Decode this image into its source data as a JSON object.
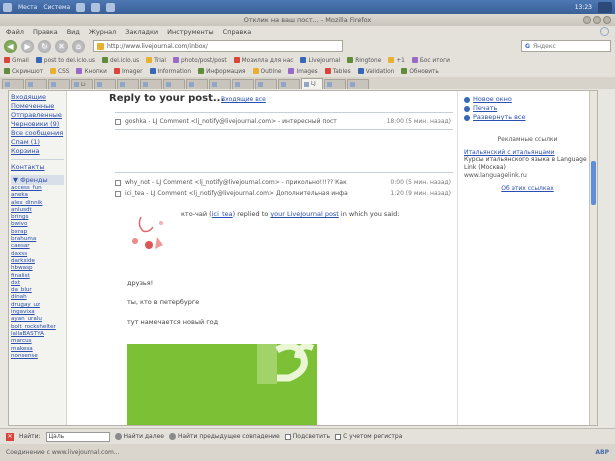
{
  "panel": {
    "labels": [
      "Места",
      "Система"
    ],
    "clock": "13:23"
  },
  "window": {
    "title": "Отклик на ваш пост... - Mozilla Firefox"
  },
  "menu": [
    "Файл",
    "Правка",
    "Вид",
    "Журнал",
    "Закладки",
    "Инструменты",
    "Справка"
  ],
  "nav": {
    "url": "http://www.livejournal.com/inbox/",
    "search_engine": "G",
    "search_placeholder": "Яндекс"
  },
  "bookmarks_row1": [
    "Gmail",
    "post to del.icio.us",
    "del.icio.us",
    "Trial",
    "photo/post/post",
    "Мозилла для нас",
    "Livejournal",
    "Ringtone",
    "+1",
    "Бос итоги"
  ],
  "bookmarks_row2": [
    "Скриншот",
    "CSS",
    "Кнопки",
    "Imager",
    "Information",
    "Информация",
    "Outline",
    "Images",
    "Tables",
    "Validation",
    "Обновить"
  ],
  "tabs": [
    "",
    "",
    "",
    "Li",
    "",
    "",
    "",
    "",
    "",
    "",
    "",
    "",
    "",
    "LJ",
    "",
    ""
  ],
  "sidebar": {
    "nav": [
      "Входящие",
      "Помеченные",
      "Отправленные",
      "Черновики (9)",
      "Все сообщения",
      "Спам (1)",
      "Корзина"
    ],
    "contacts_label": "Контакты",
    "friends_label": "Френды",
    "friends": [
      "access_fun",
      "aneka",
      "alex_dinnik",
      "anlusdt",
      "brings",
      "bwivo",
      "bxrap",
      "brahuma",
      "caesar",
      "daxss",
      "darkside",
      "hbwasp",
      "finalist",
      "dxt",
      "da_blur",
      "dinah",
      "drugay_uz",
      "ingavixa",
      "ayan_uralu",
      "bolt_rockshelter",
      "lallaBASTYA",
      "marcus",
      "makesa",
      "nonsense"
    ]
  },
  "main": {
    "title": "Reply to your post...",
    "back_link": "Входящие все",
    "rows": [
      {
        "text": "goshka - LJ Comment <lj_notify@livejournal.com> - интересный пост",
        "meta": "18:00 (5 мин. назад)"
      },
      {
        "text": "why_not - LJ Comment <lj_notify@livejournal.com> - прикольно!!!?? Как",
        "meta": "0:00 (5 мин. назад)"
      },
      {
        "text": "ici_tea - LJ Comment <lj_notify@livejournal.com> Дополнительная инфа",
        "meta": "1:20 (9 мин. назад)"
      }
    ],
    "body_user": "ici_tea",
    "body_prefix": "кто-чай (",
    "body_mid": ") replied to ",
    "body_link": "your LiveJournal post",
    "body_suffix": " in which you said:",
    "post_lines": [
      "друзья!",
      "ты, кто в петербурге",
      "тут намечается новый год"
    ]
  },
  "right": {
    "actions": [
      "Новое окно",
      "Печать",
      "Развернуть все"
    ],
    "ads_label": "Рекламные ссылки",
    "ad_title": "Итальянский с итальянцами",
    "ad_text": "Курсы итальянского языка в Language Link (Москва)",
    "ad_url": "www.languagelink.ru",
    "ads_all": "Об этих ссылках"
  },
  "findbar": {
    "label": "Найти:",
    "value": "Цаль",
    "next": "Найти далее",
    "prev": "Найти предыдущее совпадение",
    "highlight": "Подсветить",
    "match_case": "С учетом регистра"
  },
  "status": {
    "text": "Соединение с www.livejournal.com...",
    "right": "ABP"
  }
}
